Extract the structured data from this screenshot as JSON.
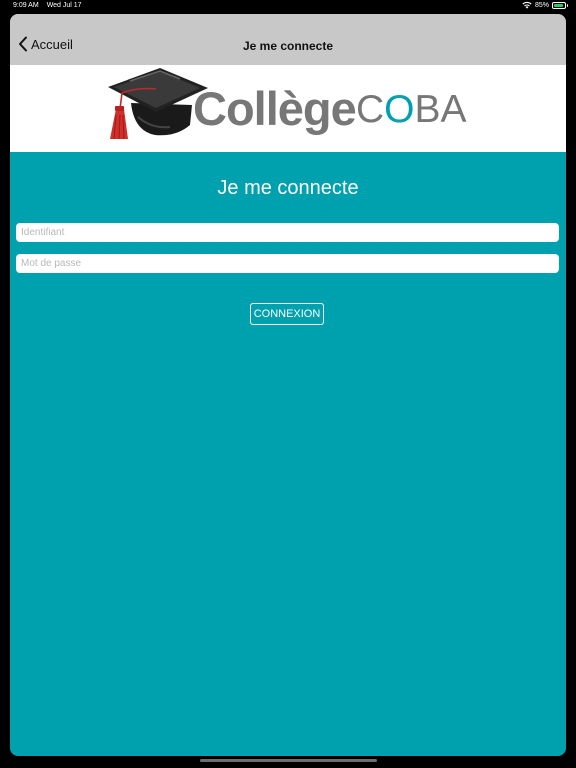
{
  "status_bar": {
    "time": "9:09 AM",
    "date": "Wed Jul 17",
    "battery_percent": "85%",
    "battery_level": 0.85,
    "icons": [
      "wifi-icon",
      "battery-icon"
    ]
  },
  "navbar": {
    "back_label": "Accueil",
    "title": "Je me connecte",
    "back_icon": "chevron-left-icon"
  },
  "logo": {
    "word": "Collège",
    "brand_c": "C",
    "brand_o": "O",
    "brand_ba": "BA",
    "icon": "graduation-cap-icon"
  },
  "main": {
    "heading": "Je me connecte",
    "username_placeholder": "Identifiant",
    "username_value": "",
    "password_placeholder": "Mot de passe",
    "password_value": "",
    "submit_label": "CONNEXION"
  },
  "colors": {
    "background": "#00a1ae",
    "navbar": "#c8c8c8",
    "logo_text": "#777777",
    "tassel": "#d0302b",
    "battery": "#34c759"
  }
}
